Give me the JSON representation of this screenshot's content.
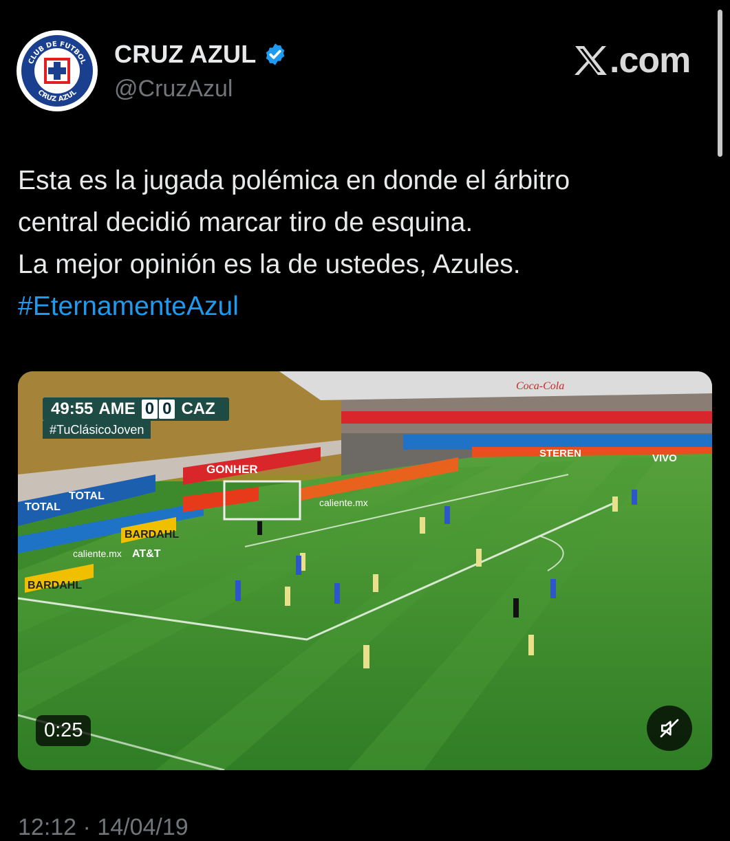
{
  "account": {
    "display_name": "CRUZ AZUL",
    "handle": "@CruzAzul",
    "verified": true,
    "avatar_icon": "cruz-azul-crest-icon",
    "avatar_text_top": "CLUB DE FUTBOL",
    "avatar_text_bottom": "CRUZ AZUL"
  },
  "brand": {
    "label": ".com",
    "icon": "x-logo-icon"
  },
  "tweet": {
    "lines": [
      "Esta es la jugada polémica en donde el árbitro",
      "central decidió marcar tiro de esquina.",
      "La mejor opinión es la de ustedes, Azules."
    ],
    "hashtag": "#EternamenteAzul",
    "timestamp": "12:12 · 14/04/19"
  },
  "video": {
    "duration": "0:25",
    "scorebug": {
      "clock": "49:55",
      "home": "AME",
      "home_score": "0",
      "away_score": "0",
      "away": "CAZ"
    },
    "hashtag_bug": "#TuClásicoJoven",
    "mute_icon": "muted-speaker-icon",
    "boards": {
      "total": "TOTAL",
      "gonher": "GONHER",
      "caliente": "caliente.mx",
      "bardahl": "BARDAHL",
      "att": "AT&T",
      "steren": "STEREN",
      "vivo": "VIVO",
      "cocacola": "Coca-Cola"
    }
  },
  "colors": {
    "background": "#000000",
    "text": "#e7e9ea",
    "muted": "#71767b",
    "link": "#1d9bf0",
    "verified": "#1d9bf0",
    "pitch": "#3c8a2c"
  }
}
